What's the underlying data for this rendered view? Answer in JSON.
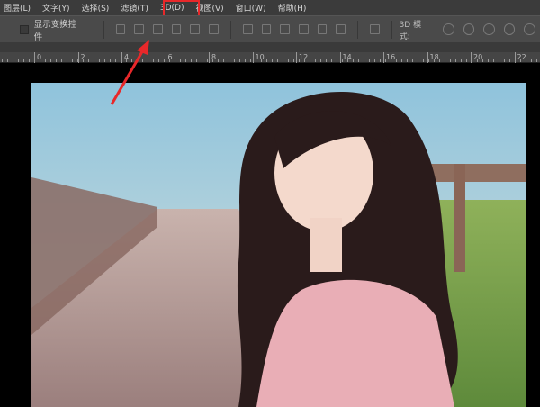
{
  "menu": [
    "图层(L)",
    "文字(Y)",
    "选择(S)",
    "滤镜(T)",
    "3D(D)",
    "视图(V)",
    "窗口(W)",
    "帮助(H)"
  ],
  "highlighted_menu": "3D(D)",
  "options": {
    "show_transform_controls": "显示变换控件",
    "checked": false,
    "mode_label": "3D 模式:"
  },
  "ruler": [
    "0",
    "2",
    "4",
    "6",
    "8",
    "10",
    "12",
    "14",
    "16",
    "18",
    "20",
    "22"
  ],
  "colors": {
    "highlight": "#e8282a",
    "menubar": "#3b3b3b",
    "options": "#4a4a4a"
  }
}
